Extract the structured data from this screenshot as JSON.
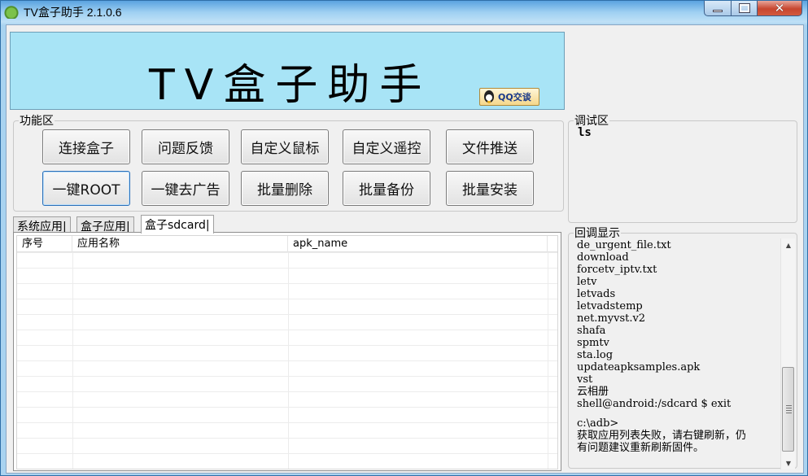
{
  "window": {
    "title": "TV盒子助手 2.1.0.6",
    "close_glyph": "✕"
  },
  "banner": {
    "title": "TV盒子助手",
    "qq_label": "QQ交谈"
  },
  "function_group": {
    "legend": "功能区",
    "buttons": [
      {
        "label": "连接盒子"
      },
      {
        "label": "问题反馈"
      },
      {
        "label": "自定义鼠标"
      },
      {
        "label": "自定义遥控"
      },
      {
        "label": "文件推送"
      },
      {
        "label": "一键ROOT"
      },
      {
        "label": "一键去广告"
      },
      {
        "label": "批量删除"
      },
      {
        "label": "批量备份"
      },
      {
        "label": "批量安装"
      }
    ]
  },
  "debug_group": {
    "legend": "调试区",
    "text": "ls"
  },
  "callback_group": {
    "legend": "回调显示",
    "lines": [
      "de_urgent_file.txt",
      "download",
      "forcetv_iptv.txt",
      "letv",
      "letvads",
      "letvadstemp",
      "net.myvst.v2",
      "shafa",
      "spmtv",
      "sta.log",
      "updateapksamples.apk",
      "vst",
      "云相册",
      "shell@android:/sdcard $ exit",
      "",
      "c:\\adb>",
      "获取应用列表失败，请右键刷新，仍",
      "有问题建议重新刷新固件。"
    ],
    "scroll_up": "▲",
    "scroll_down": "▼"
  },
  "tabs": [
    {
      "label": "系统应用|"
    },
    {
      "label": "盒子应用|"
    },
    {
      "label": "盒子sdcard|"
    }
  ],
  "table": {
    "columns": [
      "序号",
      "应用名称",
      "apk_name"
    ]
  }
}
